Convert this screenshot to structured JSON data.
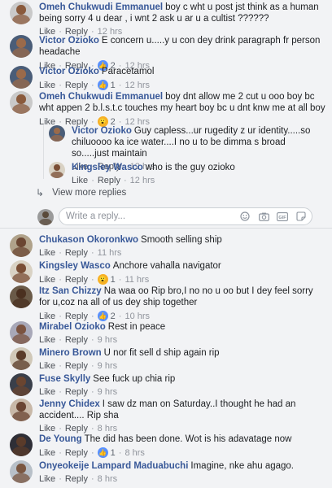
{
  "common": {
    "like": "Like",
    "reply": "Reply",
    "dot": "·"
  },
  "comments": [
    {
      "name": "Omeh Chukwudi Emmanuel",
      "text": "boy c wht u post jst think as a human being sorry 4 u dear , i wnt 2 ask u ar u a cultist ??????",
      "time": "12 hrs",
      "avatar_bg": "#c9c9c9",
      "skin": "#8a5a3c"
    },
    {
      "name": "Victor Ozioko",
      "text": "E concern u.....y u con dey drink paragraph fr person headache",
      "reaction": "like",
      "reaction_count": "2",
      "time": "12 hrs",
      "avatar_bg": "#4a5d78",
      "skin": "#9a6a4a"
    },
    {
      "name": "Victor Ozioko",
      "text": "Paracetamol",
      "reaction": "like",
      "reaction_count": "1",
      "time": "12 hrs",
      "avatar_bg": "#4a5d78",
      "skin": "#9a6a4a"
    },
    {
      "name": "Omeh Chukwudi Emmanuel",
      "text": "boy dnt allow me 2 cut u ooo boy bc wht appen 2 b.l.s.t.c touches my heart boy bc u dnt knw me at all boy",
      "reaction": "wow",
      "reaction_count": "2",
      "time": "12 hrs",
      "avatar_bg": "#c9c9c9",
      "skin": "#8a5a3c"
    },
    {
      "name": "Chukason Okoronkwo",
      "text": "Smooth selling ship",
      "time": "11 hrs",
      "avatar_bg": "#b0a28a",
      "skin": "#6b4632"
    },
    {
      "name": "Kingsley Wasco",
      "text": "Anchore vahalla navigator",
      "reaction": "wow",
      "reaction_count": "1",
      "time": "11 hrs",
      "avatar_bg": "#d9d2c4",
      "skin": "#7a4e35"
    },
    {
      "name": "Itz San Chizzy",
      "text": "Na waa oo Rip bro,I no no u oo but I dey feel sorry for u,coz na all of us dey ship together",
      "reaction": "like",
      "reaction_count": "2",
      "time": "10 hrs",
      "avatar_bg": "#6a5a48",
      "skin": "#4a3020"
    },
    {
      "name": "Mirabel Ozioko",
      "text": "Rest in peace",
      "time": "9 hrs",
      "avatar_bg": "#a8a8b8",
      "skin": "#7b5340"
    },
    {
      "name": "Minero Brown",
      "text": "U nor fit sell d ship again rip",
      "time": "9 hrs",
      "avatar_bg": "#d0c8b8",
      "skin": "#5a3b28"
    },
    {
      "name": "Fuse Skylly",
      "text": "See fuck up chia rip",
      "time": "9 hrs",
      "avatar_bg": "#3a3f4a",
      "skin": "#6a4530"
    },
    {
      "name": "Jenny Chidex",
      "text": "I saw dz man on Saturday..I thought he had an accident.... Rip sha",
      "time": "8 hrs",
      "avatar_bg": "#c8b8a8",
      "skin": "#6a4432"
    },
    {
      "name": "De Young",
      "text": "The did has been done. Wot is his adavatage now",
      "reaction": "like",
      "reaction_count": "1",
      "time": "8 hrs",
      "avatar_bg": "#2e2e36",
      "skin": "#5a3b2a"
    },
    {
      "name": "Onyeokeije Lampard Maduabuchi",
      "text": "Imagine, nke ahu agago.",
      "time": "8 hrs",
      "avatar_bg": "#b8c0c8",
      "skin": "#7a5640"
    }
  ],
  "replies": [
    {
      "name": "Victor Ozioko",
      "text": "Guy capless...ur rugedity z ur identity.....so chiluoooo ka ice water....I no u to be dimma s broad so.....just maintain",
      "time": "12 hrs",
      "avatar_bg": "#4a5d78",
      "skin": "#9a6a4a"
    },
    {
      "name": "Kingsley Wasco",
      "text": "who is the guy ozioko",
      "time": "12 hrs",
      "avatar_bg": "#d9d2c4",
      "skin": "#7a4e35"
    }
  ],
  "view_more": "View more replies",
  "reply_box": {
    "placeholder": "Write a reply...",
    "avatar_bg": "#9a9a9a",
    "skin": "#5a4a3a"
  },
  "icons": {
    "emoji": "emoji-icon",
    "camera": "camera-icon",
    "gif": "gif-icon",
    "sticker": "sticker-icon"
  },
  "colors": {
    "name": "#385898",
    "background": "#f2f3f5",
    "like_reaction": "#5890ff",
    "wow_reaction": "#f7b125"
  },
  "gif_label": "GIF"
}
